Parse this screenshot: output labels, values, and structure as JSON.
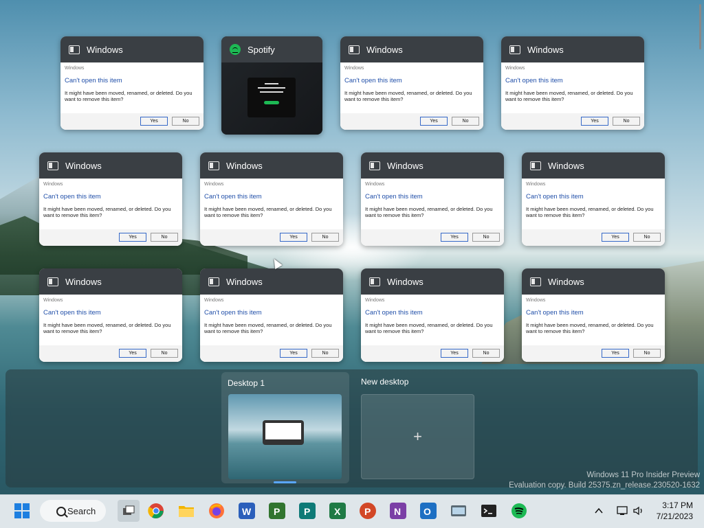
{
  "task_view": {
    "windows": [
      {
        "app": "Windows",
        "icon": "window-icon",
        "dialog": {
          "header": "Windows",
          "title": "Can't open this item",
          "message": "It might have been moved, renamed, or deleted. Do you want to remove this item?",
          "yes": "Yes",
          "no": "No"
        }
      },
      {
        "app": "Spotify",
        "icon": "spotify-icon"
      },
      {
        "app": "Windows",
        "icon": "window-icon",
        "dialog": {
          "header": "Windows",
          "title": "Can't open this item",
          "message": "It might have been moved, renamed, or deleted. Do you want to remove this item?",
          "yes": "Yes",
          "no": "No"
        }
      },
      {
        "app": "Windows",
        "icon": "window-icon",
        "dialog": {
          "header": "Windows",
          "title": "Can't open this item",
          "message": "It might have been moved, renamed, or deleted. Do you want to remove this item?",
          "yes": "Yes",
          "no": "No"
        }
      },
      {
        "app": "Windows",
        "icon": "window-icon",
        "dialog": {
          "header": "Windows",
          "title": "Can't open this item",
          "message": "It might have been moved, renamed, or deleted. Do you want to remove this item?",
          "yes": "Yes",
          "no": "No"
        }
      },
      {
        "app": "Windows",
        "icon": "window-icon",
        "dialog": {
          "header": "Windows",
          "title": "Can't open this item",
          "message": "It might have been moved, renamed, or deleted. Do you want to remove this item?",
          "yes": "Yes",
          "no": "No"
        }
      },
      {
        "app": "Windows",
        "icon": "window-icon",
        "dialog": {
          "header": "Windows",
          "title": "Can't open this item",
          "message": "It might have been moved, renamed, or deleted. Do you want to remove this item?",
          "yes": "Yes",
          "no": "No"
        }
      },
      {
        "app": "Windows",
        "icon": "window-icon",
        "dialog": {
          "header": "Windows",
          "title": "Can't open this item",
          "message": "It might have been moved, renamed, or deleted. Do you want to remove this item?",
          "yes": "Yes",
          "no": "No"
        }
      },
      {
        "app": "Windows",
        "icon": "window-icon",
        "dialog": {
          "header": "Windows",
          "title": "Can't open this item",
          "message": "It might have been moved, renamed, or deleted. Do you want to remove this item?",
          "yes": "Yes",
          "no": "No"
        }
      },
      {
        "app": "Windows",
        "icon": "window-icon",
        "dialog": {
          "header": "Windows",
          "title": "Can't open this item",
          "message": "It might have been moved, renamed, or deleted. Do you want to remove this item?",
          "yes": "Yes",
          "no": "No"
        }
      },
      {
        "app": "Windows",
        "icon": "window-icon",
        "dialog": {
          "header": "Windows",
          "title": "Can't open this item",
          "message": "It might have been moved, renamed, or deleted. Do you want to remove this item?",
          "yes": "Yes",
          "no": "No"
        }
      },
      {
        "app": "Windows",
        "icon": "window-icon",
        "dialog": {
          "header": "Windows",
          "title": "Can't open this item",
          "message": "It might have been moved, renamed, or deleted. Do you want to remove this item?",
          "yes": "Yes",
          "no": "No"
        }
      }
    ]
  },
  "desktops": {
    "desktop1_label": "Desktop 1",
    "new_desktop_label": "New desktop",
    "new_desktop_glyph": "+"
  },
  "watermark": {
    "line1": "Windows 11 Pro Insider Preview",
    "line2": "Evaluation copy. Build 25375.zn_release.230520-1632"
  },
  "taskbar": {
    "search_label": "Search",
    "time": "3:17 PM",
    "date": "7/21/2023",
    "apps": [
      "start-icon",
      "task-view-icon",
      "chrome-icon",
      "file-explorer-icon",
      "firefox-icon",
      "word-icon",
      "project-icon",
      "publisher-icon",
      "excel-icon",
      "powerpoint-icon",
      "onenote-icon",
      "outlook-icon",
      "keyboard-app-icon",
      "terminal-icon",
      "spotify-icon"
    ],
    "colors": {
      "windows_blue": "#1d7fe0",
      "word": "#2b5fbb",
      "excel": "#1f7a45",
      "powerpoint": "#d24726",
      "onenote": "#7b3fa6",
      "outlook": "#1d6fc3",
      "project": "#31752f",
      "publisher": "#0e7a77",
      "spotify": "#1db954"
    }
  }
}
